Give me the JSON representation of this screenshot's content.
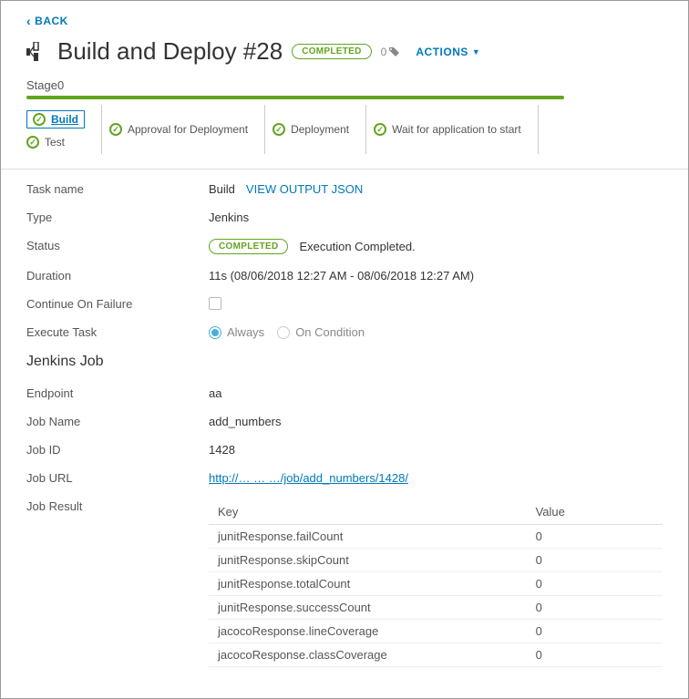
{
  "back_label": "BACK",
  "title": "Build and Deploy #28",
  "status_pill": "COMPLETED",
  "tag_count": "0",
  "actions_label": "ACTIONS",
  "stage_name": "Stage0",
  "stage_groups": [
    {
      "tasks": [
        {
          "label": "Build",
          "selected": true
        },
        {
          "label": "Test",
          "selected": false
        }
      ]
    },
    {
      "tasks": [
        {
          "label": "Approval for Deployment",
          "selected": false
        }
      ]
    },
    {
      "tasks": [
        {
          "label": "Deployment",
          "selected": false
        }
      ]
    },
    {
      "tasks": [
        {
          "label": "Wait for application to start",
          "selected": false
        }
      ]
    }
  ],
  "details": {
    "task_name_label": "Task name",
    "task_name": "Build",
    "view_output_json": "VIEW OUTPUT JSON",
    "type_label": "Type",
    "type_value": "Jenkins",
    "status_label": "Status",
    "status_pill": "COMPLETED",
    "status_text": "Execution Completed.",
    "duration_label": "Duration",
    "duration_value": "11s (08/06/2018 12:27 AM - 08/06/2018 12:27 AM)",
    "continue_label": "Continue On Failure",
    "execute_label": "Execute Task",
    "exec_always": "Always",
    "exec_condition": "On Condition"
  },
  "jenkins_heading": "Jenkins Job",
  "jenkins": {
    "endpoint_label": "Endpoint",
    "endpoint_value": "aa",
    "jobname_label": "Job Name",
    "jobname_value": "add_numbers",
    "jobid_label": "Job ID",
    "jobid_value": "1428",
    "joburl_label": "Job URL",
    "joburl_value": "http://… … …/job/add_numbers/1428/",
    "jobresult_label": "Job Result",
    "table_key_header": "Key",
    "table_value_header": "Value",
    "results": [
      {
        "key": "junitResponse.failCount",
        "value": "0"
      },
      {
        "key": "junitResponse.skipCount",
        "value": "0"
      },
      {
        "key": "junitResponse.totalCount",
        "value": "0"
      },
      {
        "key": "junitResponse.successCount",
        "value": "0"
      },
      {
        "key": "jacocoResponse.lineCoverage",
        "value": "0"
      },
      {
        "key": "jacocoResponse.classCoverage",
        "value": "0"
      }
    ]
  }
}
